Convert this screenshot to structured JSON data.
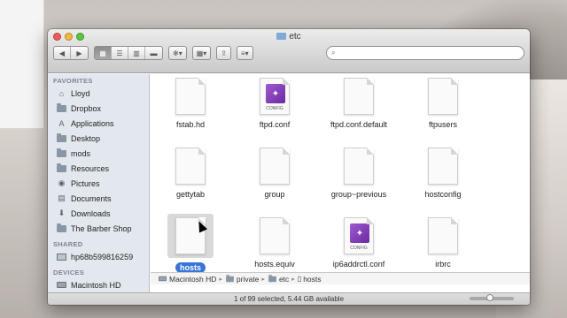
{
  "window": {
    "title": "etc"
  },
  "toolbar": {
    "back": "◀",
    "forward": "▶",
    "views": [
      "▦",
      "☰",
      "▥",
      "▬"
    ],
    "action": "✻▾",
    "arrange": "▦▾",
    "share": "⇪",
    "path": "≡▾",
    "search_placeholder": ""
  },
  "sidebar": {
    "favorites_header": "FAVORITES",
    "favorites": [
      {
        "label": "Lloyd",
        "icon": "home-icon"
      },
      {
        "label": "Dropbox",
        "icon": "dropbox-folder-icon"
      },
      {
        "label": "Applications",
        "icon": "applications-icon"
      },
      {
        "label": "Desktop",
        "icon": "folder-icon"
      },
      {
        "label": "mods",
        "icon": "folder-icon"
      },
      {
        "label": "Resources",
        "icon": "folder-icon"
      },
      {
        "label": "Pictures",
        "icon": "camera-icon"
      },
      {
        "label": "Documents",
        "icon": "documents-icon"
      },
      {
        "label": "Downloads",
        "icon": "downloads-icon"
      },
      {
        "label": "The Barber Shop",
        "icon": "folder-icon"
      }
    ],
    "shared_header": "SHARED",
    "shared": [
      {
        "label": "hp68b599816259",
        "icon": "computer-icon"
      }
    ],
    "devices_header": "DEVICES",
    "devices": [
      {
        "label": "Macintosh HD",
        "icon": "disk-icon"
      }
    ]
  },
  "files": [
    {
      "name": "fstab.hd",
      "type": "doc"
    },
    {
      "name": "ftpd.conf",
      "type": "config",
      "badge": "CONFIG"
    },
    {
      "name": "ftpd.conf.default",
      "type": "doc"
    },
    {
      "name": "ftpusers",
      "type": "doc"
    },
    {
      "name": "gettytab",
      "type": "doc"
    },
    {
      "name": "group",
      "type": "doc"
    },
    {
      "name": "group~previous",
      "type": "doc"
    },
    {
      "name": "hostconfig",
      "type": "doc"
    },
    {
      "name": "hosts",
      "type": "doc",
      "selected": true
    },
    {
      "name": "hosts.equiv",
      "type": "doc"
    },
    {
      "name": "ip6addrctl.conf",
      "type": "config",
      "badge": "CONFIG"
    },
    {
      "name": "irbrc",
      "type": "doc"
    }
  ],
  "pathbar": [
    "Macintosh HD",
    "private",
    "etc",
    "hosts"
  ],
  "status": {
    "text": "1 of 99 selected, 5.44 GB available",
    "icon_size_level": 0.45
  }
}
